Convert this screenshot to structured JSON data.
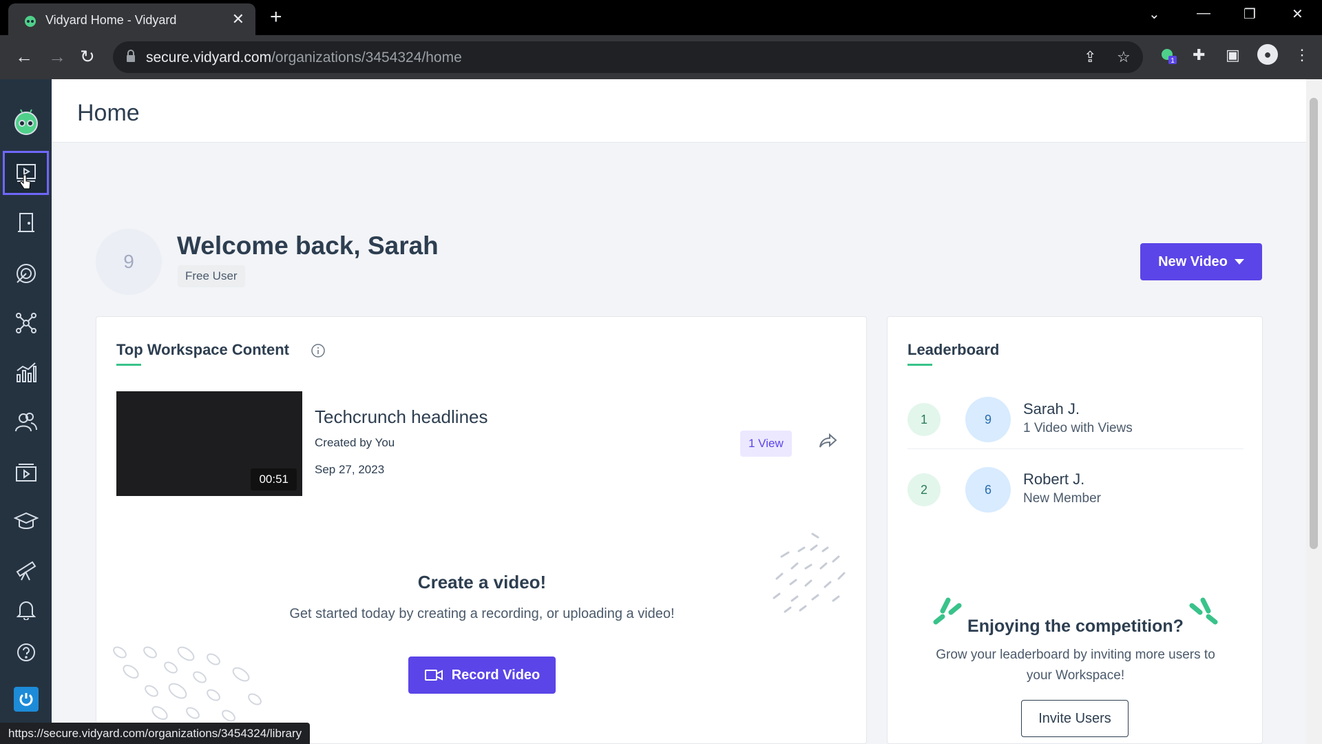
{
  "browser": {
    "tab_title": "Vidyard Home - Vidyard",
    "url_host": "secure.vidyard.com",
    "url_path": "/organizations/3454324/home",
    "extension_badge": "1",
    "status_url": "https://secure.vidyard.com/organizations/3454324/library"
  },
  "sidebar": {
    "items": [
      {
        "icon": "play-screen-icon",
        "active": true
      },
      {
        "icon": "building-icon"
      },
      {
        "icon": "target-icon"
      },
      {
        "icon": "network-icon"
      },
      {
        "icon": "analytics-icon"
      },
      {
        "icon": "users-icon"
      },
      {
        "icon": "video-library-icon"
      },
      {
        "icon": "graduation-cap-icon"
      },
      {
        "icon": "telescope-icon"
      },
      {
        "icon": "bell-icon"
      },
      {
        "icon": "help-icon"
      },
      {
        "icon": "power-icon"
      }
    ]
  },
  "header": {
    "title": "Home"
  },
  "welcome": {
    "avatar_initial": "9",
    "greeting": "Welcome back, Sarah",
    "plan_badge": "Free User",
    "new_video_label": "New Video"
  },
  "top_content": {
    "title": "Top Workspace Content",
    "video": {
      "duration": "00:51",
      "title": "Techcrunch headlines",
      "created_by": "Created by You",
      "date": "Sep 27, 2023",
      "views": "1 View"
    },
    "create": {
      "title": "Create a video!",
      "description": "Get started today by creating a recording, or uploading a video!",
      "button": "Record Video"
    }
  },
  "leaderboard": {
    "title": "Leaderboard",
    "rows": [
      {
        "rank": "1",
        "avatar": "9",
        "name": "Sarah J.",
        "sub": "1 Video with Views"
      },
      {
        "rank": "2",
        "avatar": "6",
        "name": "Robert J.",
        "sub": "New Member"
      }
    ],
    "promo": {
      "title": "Enjoying the competition?",
      "description": "Grow your leaderboard by inviting more users to your Workspace!",
      "button": "Invite Users"
    }
  },
  "colors": {
    "brand_purple": "#5b45e8",
    "sidebar": "#253341",
    "accent_green": "#39c38a"
  }
}
